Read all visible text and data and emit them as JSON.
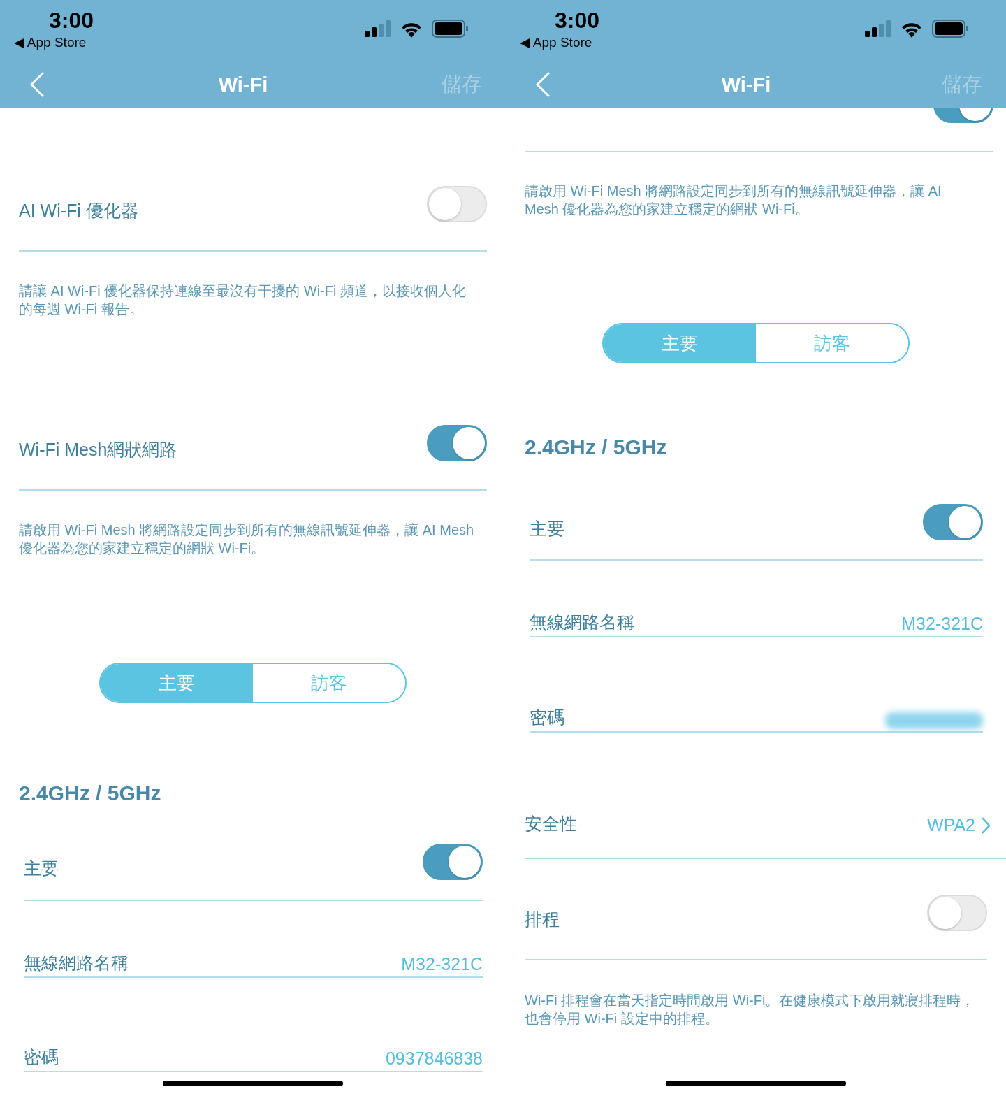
{
  "panels": [
    {
      "status_bar": {
        "time": "3:00",
        "back_app": "◀ App Store"
      },
      "nav": {
        "title": "Wi-Fi",
        "save": "儲存"
      },
      "items": [
        {
          "kind": "toggle",
          "label": "AI Wi-Fi 優化器",
          "on": false
        },
        {
          "kind": "note",
          "text": "請讓 AI Wi-Fi 優化器保持連線至最沒有干擾的 Wi-Fi 頻道，以接收個人化的每週 Wi-Fi 報告。"
        },
        {
          "kind": "toggle",
          "label": "Wi-Fi Mesh網狀網路",
          "on": true
        },
        {
          "kind": "note",
          "text": "請啟用 Wi-Fi Mesh 將網路設定同步到所有的無線訊號延伸器，讓 AI Mesh 優化器為您的家建立穩定的網狀 Wi-Fi。"
        },
        {
          "kind": "segmented",
          "options": [
            {
              "label": "主要",
              "selected": true
            },
            {
              "label": "訪客",
              "selected": false
            }
          ]
        },
        {
          "kind": "heading",
          "text": "2.4GHz / 5GHz"
        },
        {
          "kind": "toggle",
          "label": "主要",
          "on": true
        },
        {
          "kind": "value",
          "label": "無線網路名稱",
          "value": "M32-321C"
        },
        {
          "kind": "value",
          "label": "密碼",
          "value": "0937846838"
        }
      ]
    },
    {
      "status_bar": {
        "time": "3:00",
        "back_app": "◀ App Store"
      },
      "nav": {
        "title": "Wi-Fi",
        "save": "儲存"
      },
      "items": [
        {
          "kind": "cut-toggle",
          "on": true
        },
        {
          "kind": "note",
          "text": "請啟用 Wi-Fi Mesh 將網路設定同步到所有的無線訊號延伸器，讓 AI Mesh 優化器為您的家建立穩定的網狀 Wi-Fi。"
        },
        {
          "kind": "segmented",
          "options": [
            {
              "label": "主要",
              "selected": true
            },
            {
              "label": "訪客",
              "selected": false
            }
          ]
        },
        {
          "kind": "heading",
          "text": "2.4GHz / 5GHz"
        },
        {
          "kind": "toggle",
          "label": "主要",
          "on": true
        },
        {
          "kind": "value",
          "label": "無線網路名稱",
          "value": "M32-321C"
        },
        {
          "kind": "value",
          "label": "密碼",
          "redacted": true
        },
        {
          "kind": "link",
          "label": "安全性",
          "value": "WPA2"
        },
        {
          "kind": "toggle",
          "label": "排程",
          "on": false
        },
        {
          "kind": "note",
          "text": "Wi-Fi 排程會在當天指定時間啟用 Wi-Fi。在健康模式下啟用就寢排程時，也會停用 Wi-Fi 設定中的排程。"
        }
      ]
    }
  ]
}
